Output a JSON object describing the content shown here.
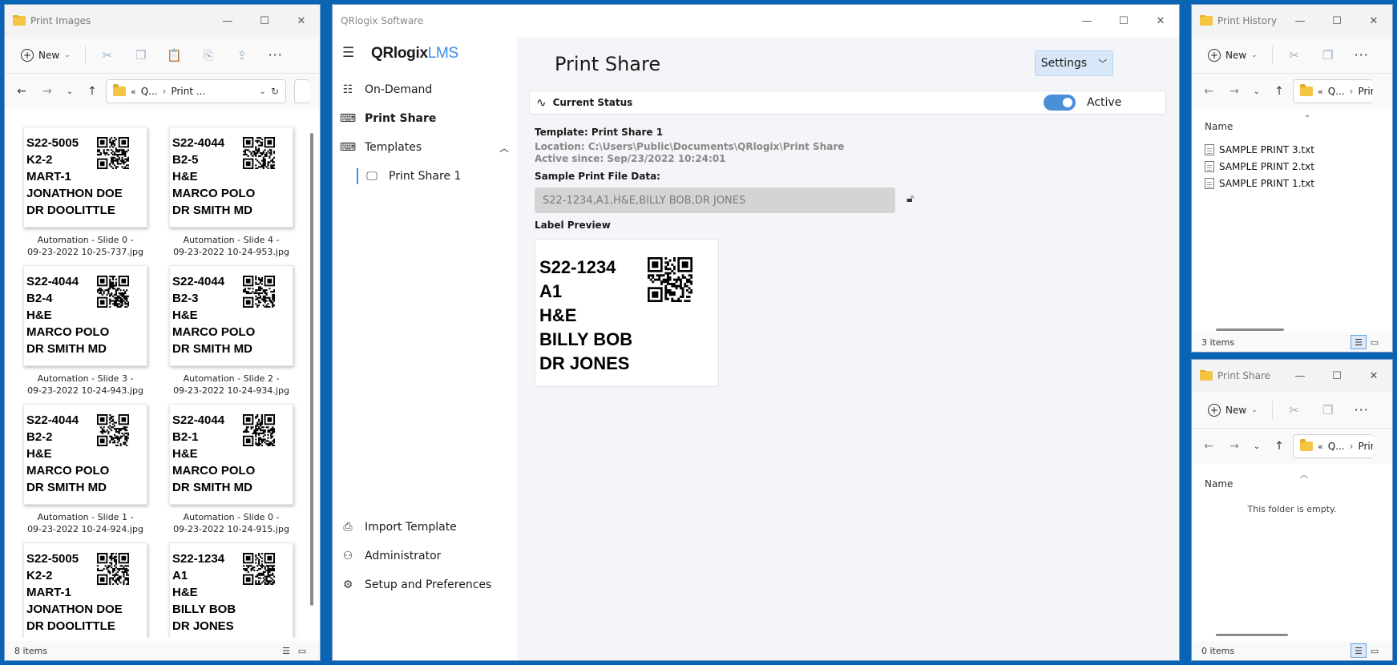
{
  "print_images": {
    "title": "Print Images",
    "toolbar": {
      "new_label": "New"
    },
    "address": {
      "part1": "Q...",
      "part2": "Print ..."
    },
    "status": "8 items",
    "labels": [
      {
        "lines": [
          "S22-5005",
          "K2-2",
          "MART-1",
          "JONATHON DOE",
          "DR DOOLITTLE"
        ],
        "caption1": "Automation - Slide 0 -",
        "caption2": "09-23-2022 10-25-737.jpg"
      },
      {
        "lines": [
          "S22-4044",
          "B2-5",
          "H&E",
          "MARCO POLO",
          "DR SMITH MD"
        ],
        "caption1": "Automation - Slide 4 -",
        "caption2": "09-23-2022 10-24-953.jpg"
      },
      {
        "lines": [
          "S22-4044",
          "B2-4",
          "H&E",
          "MARCO POLO",
          "DR SMITH MD"
        ],
        "caption1": "Automation - Slide 3 -",
        "caption2": "09-23-2022 10-24-943.jpg"
      },
      {
        "lines": [
          "S22-4044",
          "B2-3",
          "H&E",
          "MARCO POLO",
          "DR SMITH MD"
        ],
        "caption1": "Automation - Slide 2 -",
        "caption2": "09-23-2022 10-24-934.jpg"
      },
      {
        "lines": [
          "S22-4044",
          "B2-2",
          "H&E",
          "MARCO POLO",
          "DR SMITH MD"
        ],
        "caption1": "Automation - Slide 1 -",
        "caption2": "09-23-2022 10-24-924.jpg"
      },
      {
        "lines": [
          "S22-4044",
          "B2-1",
          "H&E",
          "MARCO POLO",
          "DR SMITH MD"
        ],
        "caption1": "Automation - Slide 0 -",
        "caption2": "09-23-2022 10-24-915.jpg"
      },
      {
        "lines": [
          "S22-5005",
          "K2-2",
          "MART-1",
          "JONATHON DOE",
          "DR DOOLITTLE"
        ],
        "caption1": "",
        "caption2": ""
      },
      {
        "lines": [
          "S22-1234",
          "A1",
          "H&E",
          "BILLY BOB",
          "DR JONES"
        ],
        "caption1": "",
        "caption2": ""
      }
    ]
  },
  "app": {
    "window_title": "QRlogix Software",
    "logo_main": "QRlogix",
    "logo_accent": "LMS",
    "nav": {
      "on_demand": "On-Demand",
      "print_share": "Print Share",
      "templates": "Templates",
      "print_share_1": "Print Share 1",
      "import_template": "Import Template",
      "administrator": "Administrator",
      "setup": "Setup and Preferences"
    },
    "page_title": "Print Share",
    "settings_label": "Settings",
    "current_status_label": "Current Status",
    "active_label": "Active",
    "template_line": "Template: Print Share 1",
    "location_line": "Location: C:\\Users\\Public\\Documents\\QRlogix\\Print Share",
    "active_since_line": "Active since: Sep/23/2022 10:24:01",
    "sample_label": "Sample Print File Data:",
    "sample_value": "S22-1234,A1,H&E,BILLY BOB,DR JONES",
    "preview_label": "Label Preview",
    "preview_lines": [
      "S22-1234",
      "A1",
      "H&E",
      "BILLY BOB",
      "DR JONES"
    ]
  },
  "print_history": {
    "title": "Print History",
    "new_label": "New",
    "address": {
      "part1": "Q...",
      "part2": "Print"
    },
    "column_name": "Name",
    "files": [
      "SAMPLE PRINT 3.txt",
      "SAMPLE PRINT 2.txt",
      "SAMPLE PRINT 1.txt"
    ],
    "status": "3 items"
  },
  "print_share_win": {
    "title": "Print Share",
    "new_label": "New",
    "address": {
      "part1": "Q...",
      "part2": "Print"
    },
    "column_name": "Name",
    "empty_text": "This folder is empty.",
    "status": "0 items"
  },
  "colors": {
    "desktop": "#0a64b4",
    "accent": "#4a90d9",
    "logo_accent": "#3a8ee6"
  }
}
